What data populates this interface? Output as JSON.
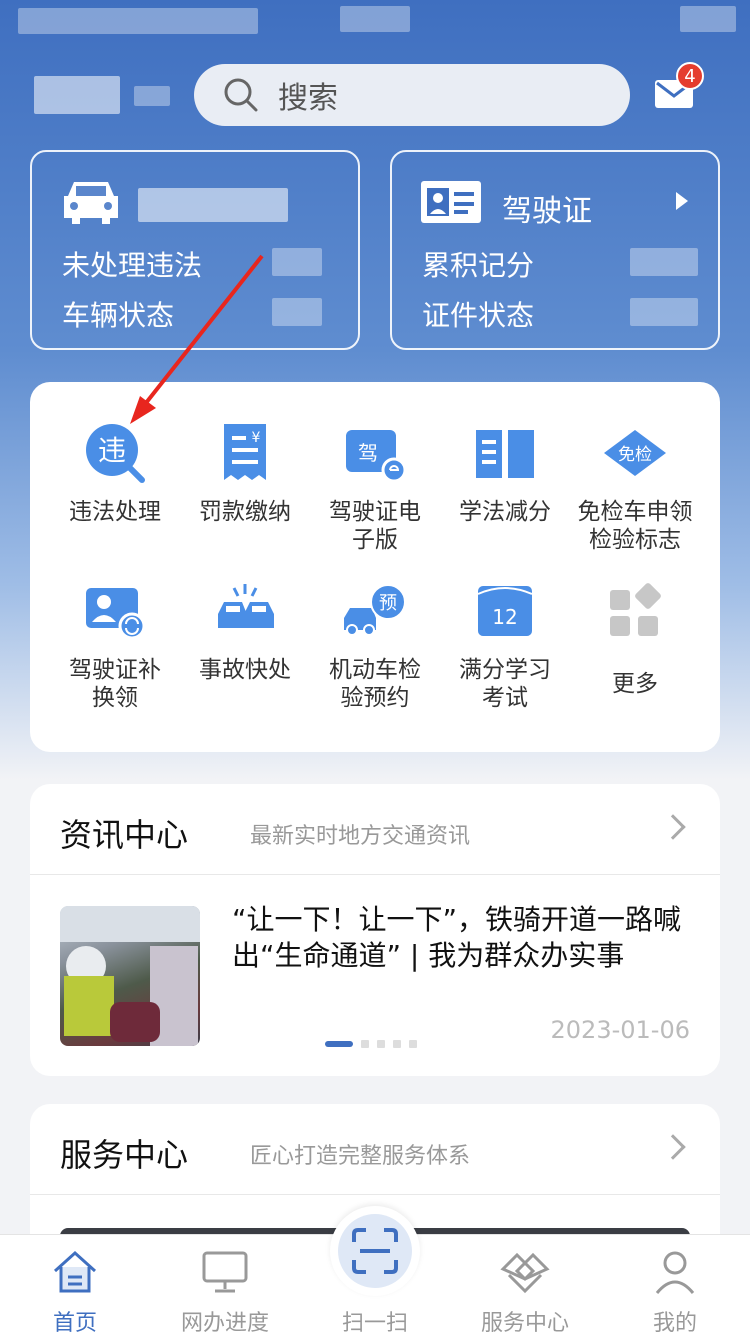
{
  "search": {
    "placeholder": "搜索"
  },
  "mail": {
    "badge": "4"
  },
  "vehicle_card": {
    "row1": "未处理违法",
    "row2": "车辆状态"
  },
  "license_card": {
    "title": "驾驶证",
    "row1": "累积记分",
    "row2": "证件状态"
  },
  "services": [
    {
      "label": "违法处理",
      "icon": "violation-icon"
    },
    {
      "label": "罚款缴纳",
      "icon": "fine-payment-icon"
    },
    {
      "label": "驾驶证电子版",
      "icon": "e-license-icon"
    },
    {
      "label": "学法减分",
      "icon": "study-book-icon"
    },
    {
      "label": "免检车申领检验标志",
      "icon": "exempt-inspection-icon"
    },
    {
      "label": "驾驶证补换领",
      "icon": "license-replace-icon"
    },
    {
      "label": "事故快处",
      "icon": "accident-icon"
    },
    {
      "label": "机动车检验预约",
      "icon": "inspection-booking-icon"
    },
    {
      "label": "满分学习考试",
      "icon": "calendar-exam-icon"
    },
    {
      "label": "更多",
      "icon": "more-grid-icon"
    }
  ],
  "calendar_number": "12",
  "exempt_badge": "免检",
  "violation_char": "违",
  "booking_char": "预",
  "license_char": "驾",
  "news": {
    "heading": "资讯中心",
    "subtitle": "最新实时地方交通资讯",
    "title": "“让一下！让一下”，铁骑开道一路喊出“生命通道” | 我为群众办实事",
    "date": "2023-01-06"
  },
  "service_center": {
    "heading": "服务中心",
    "subtitle": "匠心打造完整服务体系"
  },
  "tabbar": [
    {
      "label": "首页",
      "icon": "home-icon"
    },
    {
      "label": "网办进度",
      "icon": "monitor-icon"
    },
    {
      "label": "扫一扫",
      "icon": "scan-icon"
    },
    {
      "label": "服务中心",
      "icon": "service-icon"
    },
    {
      "label": "我的",
      "icon": "user-icon"
    }
  ],
  "colors": {
    "primary": "#3f6fc0",
    "badge": "#e53c2e",
    "icon_blue": "#4a8ee6"
  }
}
